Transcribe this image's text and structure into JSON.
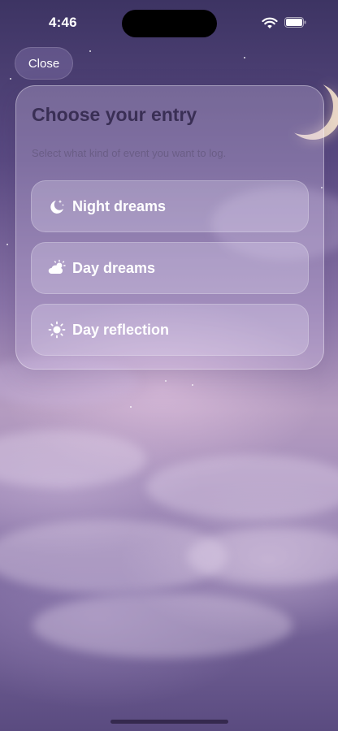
{
  "status_bar": {
    "time": "4:46"
  },
  "header": {
    "close_label": "Close"
  },
  "card": {
    "title": "Choose your entry",
    "subtitle": "Select what kind of event you want to log.",
    "options": [
      {
        "label": "Night dreams",
        "icon": "moon-stars-icon"
      },
      {
        "label": "Day dreams",
        "icon": "cloud-sun-icon"
      },
      {
        "label": "Day reflection",
        "icon": "sun-icon"
      }
    ]
  },
  "colors": {
    "title_text": "#3a2f55",
    "subtitle_text": "#6a5d86",
    "option_text": "#ffffff",
    "sky_top": "#3d3463",
    "sky_mid": "#b59cc0"
  }
}
